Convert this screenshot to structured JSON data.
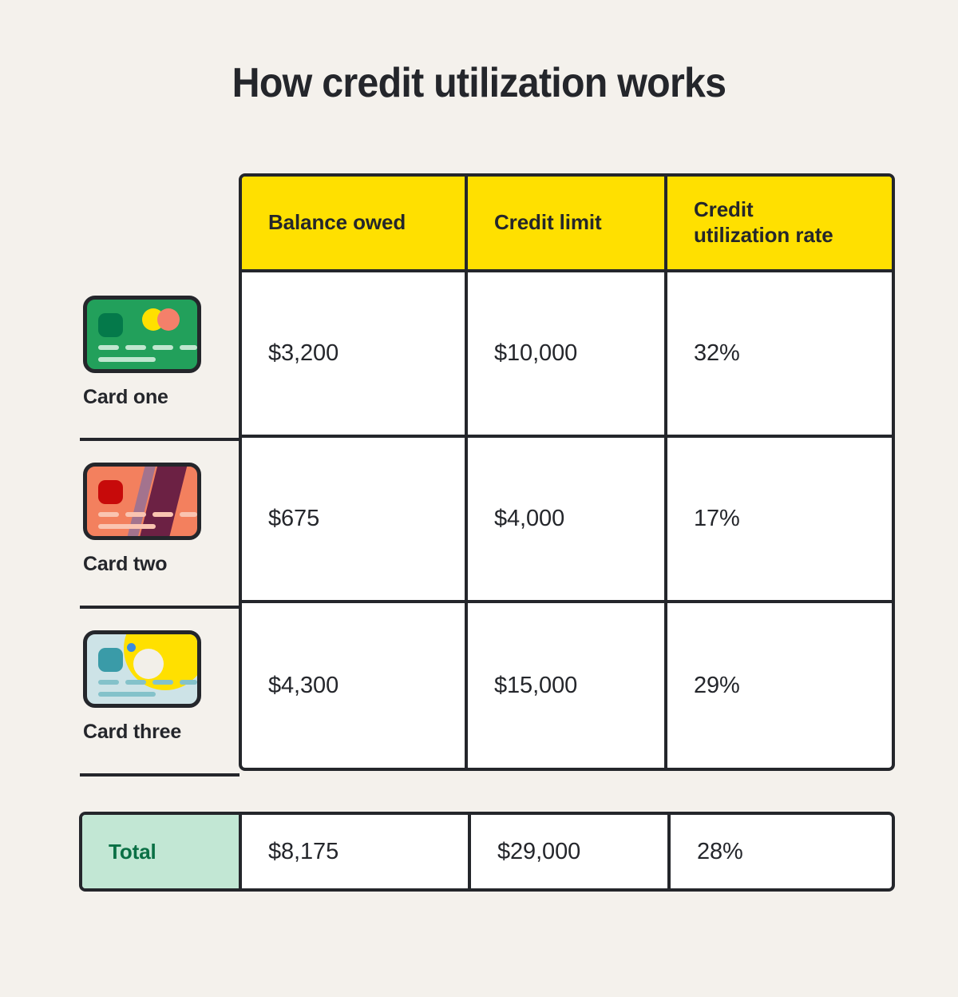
{
  "page": {
    "title": "How credit utilization works",
    "background_color": "#F4F1EC",
    "ink_color": "#24262B"
  },
  "table": {
    "headers": {
      "row_label": "",
      "balance": "Balance owed",
      "limit": "Credit limit",
      "rate_line1": "Credit",
      "rate_line2": "utilization rate"
    },
    "header_background": "#FFE000",
    "rows": [
      {
        "label": "Card one",
        "icon": "credit-card-green-icon",
        "balance": "$3,200",
        "limit": "$10,000",
        "rate": "32%",
        "card_colors": {
          "base": "#22A05B",
          "chip": "#04794A",
          "circle_left": "#FFE000",
          "circle_right": "#F4806A",
          "lines": "#BFE6CF"
        }
      },
      {
        "label": "Card two",
        "icon": "credit-card-salmon-icon",
        "balance": "$675",
        "limit": "$4,000",
        "rate": "17%",
        "card_colors": {
          "base": "#F3805E",
          "chip": "#C70A0A",
          "stripe_thin": "#A3738E",
          "stripe_wide": "#6C2144",
          "lines": "#FAC4B1"
        }
      },
      {
        "label": "Card three",
        "icon": "credit-card-blue-icon",
        "balance": "$4,300",
        "limit": "$15,000",
        "rate": "29%",
        "card_colors": {
          "base": "#CDE3E7",
          "chip": "#3A9BA8",
          "sun": "#FFE000",
          "moon": "#F2EFE9",
          "dot": "#3A8BE0",
          "lines": "#84C2CA"
        }
      }
    ],
    "total": {
      "label": "Total",
      "label_background": "#C2E7D4",
      "label_color": "#0A7045",
      "balance": "$8,175",
      "limit": "$29,000",
      "rate": "28%"
    }
  }
}
